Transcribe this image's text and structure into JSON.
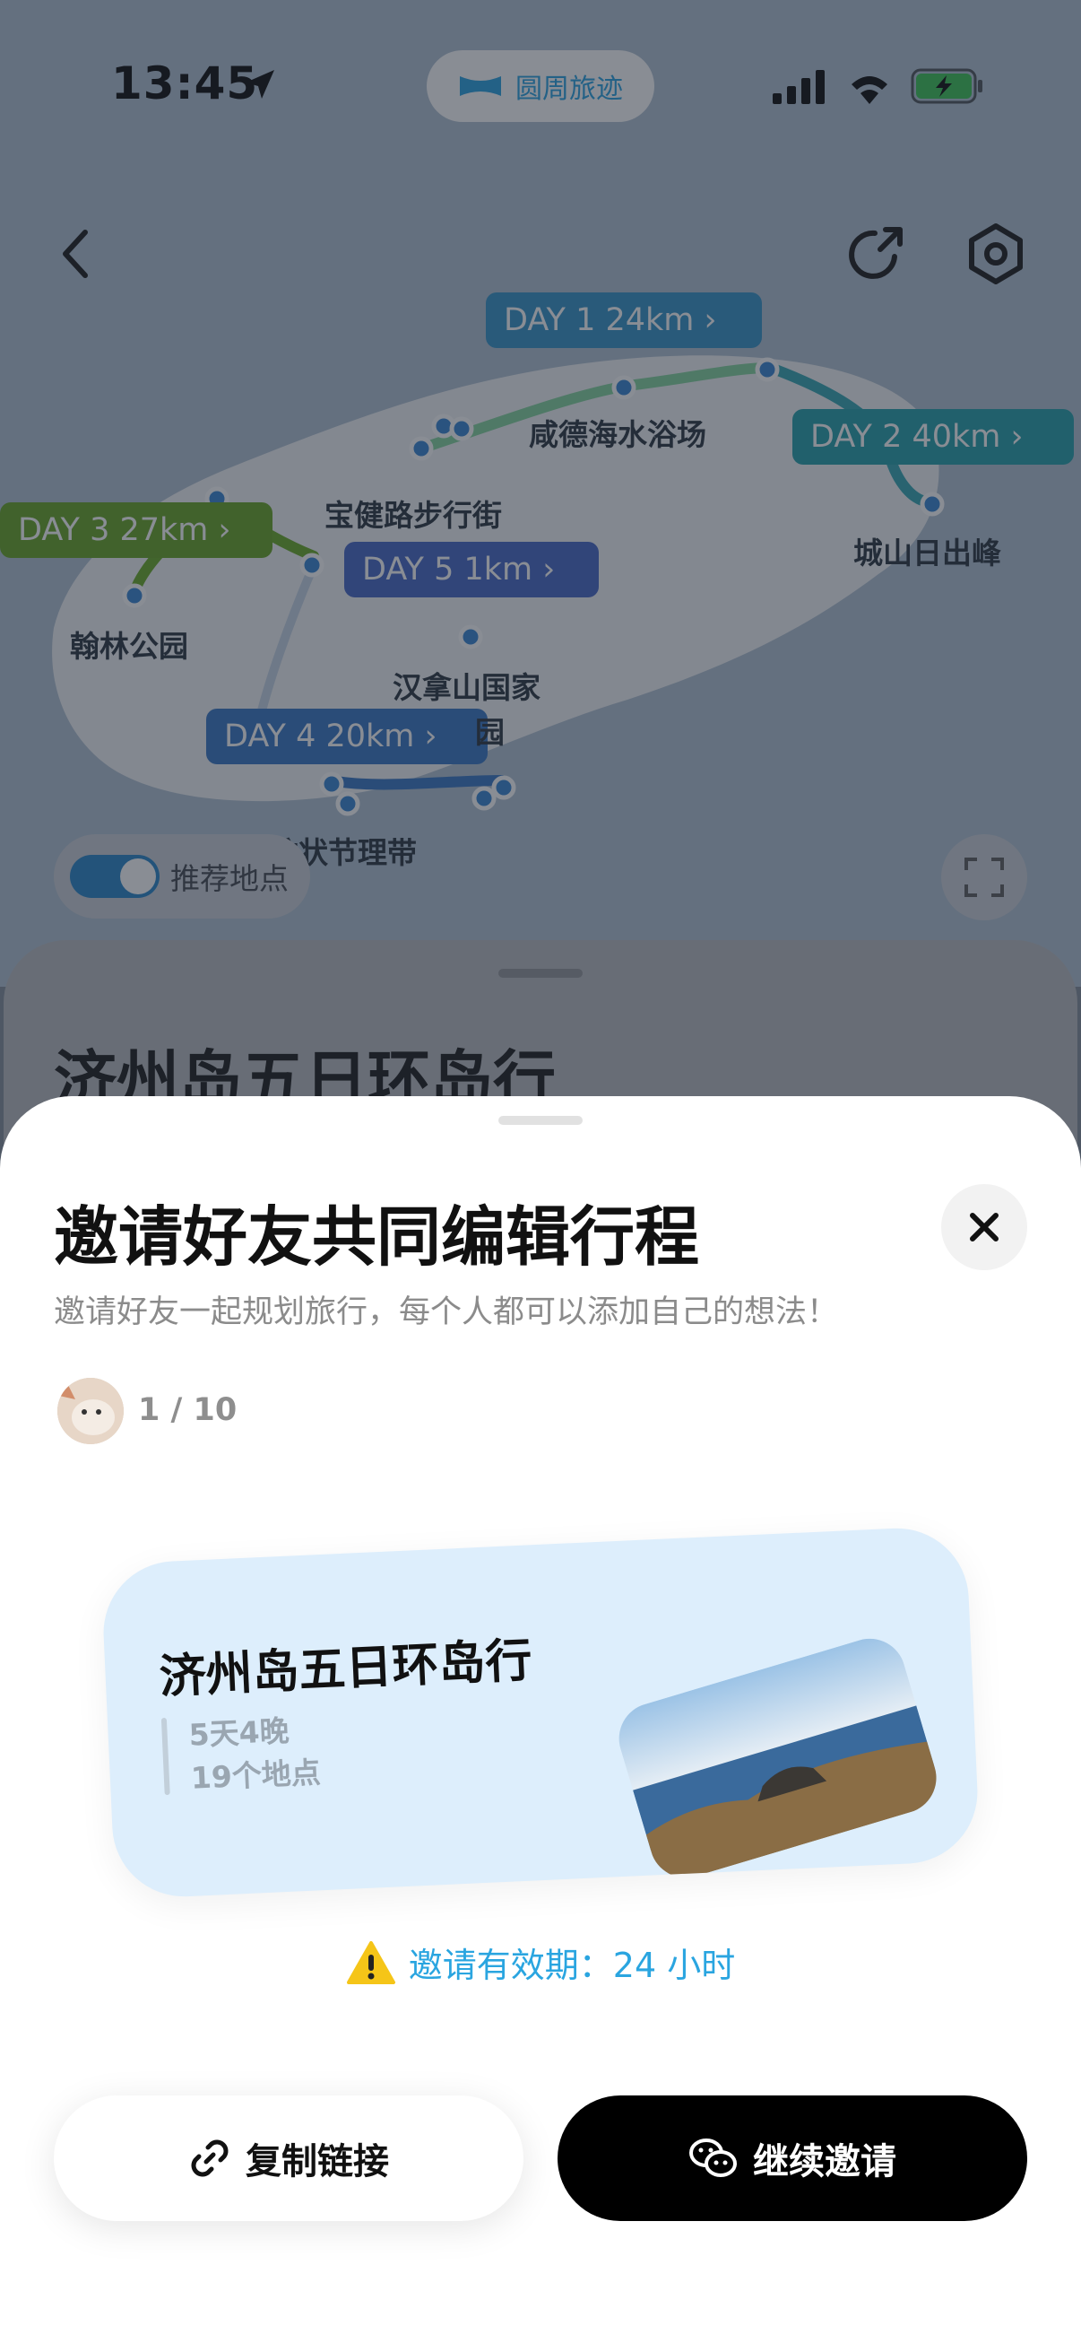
{
  "status": {
    "time": "13:45"
  },
  "app_pill": {
    "label": "圆周旅迹"
  },
  "map": {
    "day_tags": [
      {
        "label": "DAY 1 24km ›",
        "color": "#2a8fc6"
      },
      {
        "label": "DAY 2 40km ›",
        "color": "#1a9ba6"
      },
      {
        "label": "DAY 3 27km ›",
        "color": "#5f9f1a"
      },
      {
        "label": "DAY 5 1km ›",
        "color": "#3d5fc4"
      },
      {
        "label": "DAY 4 20km ›",
        "color": "#2e6fc0"
      }
    ],
    "places": [
      "咸德海水浴场",
      "宝健路步行街",
      "城山日出峰",
      "翰林公园",
      "汉拿山国家",
      "园",
      "柱状节理带"
    ]
  },
  "recommend_toggle": {
    "label": "推荐地点",
    "on": true
  },
  "underlying": {
    "title": "济州岛五日环岛行"
  },
  "modal": {
    "title": "邀请好友共同编辑行程",
    "subtitle": "邀请好友一起规划旅行，每个人都可以添加自己的想法！",
    "member_count": "1 / 10",
    "card": {
      "title": "济州岛五日环岛行",
      "duration": "5天4晚",
      "places": "19个地点"
    },
    "validity": "邀请有效期：24 小时",
    "copy_label": "复制链接",
    "invite_label": "继续邀请"
  },
  "colors": {
    "accent": "#2aa5e0",
    "primary_button": "#000000"
  }
}
